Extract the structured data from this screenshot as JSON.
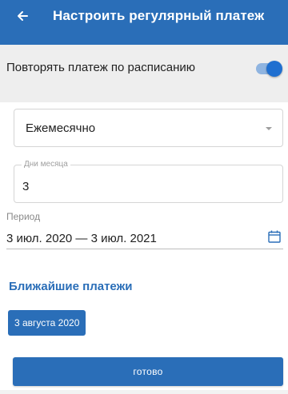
{
  "appbar": {
    "title": "Настроить регулярный платеж",
    "back_icon": "arrow-left-icon",
    "background_color": "#2a6eb8"
  },
  "repeat": {
    "label": "Повторять платеж по расписанию",
    "toggle_on": true,
    "toggle_color": "#1f6fd0"
  },
  "frequency": {
    "selected": "Ежемесячно",
    "icon": "caret-down-icon"
  },
  "month_days": {
    "label": "Дни месяца",
    "value": "3"
  },
  "period": {
    "label": "Период",
    "value": "3 июл. 2020 — 3 июл. 2021",
    "icon": "calendar-icon"
  },
  "upcoming": {
    "title": "Ближайшие платежи",
    "chips": [
      "3 августа 2020"
    ]
  },
  "done_label": "готово"
}
